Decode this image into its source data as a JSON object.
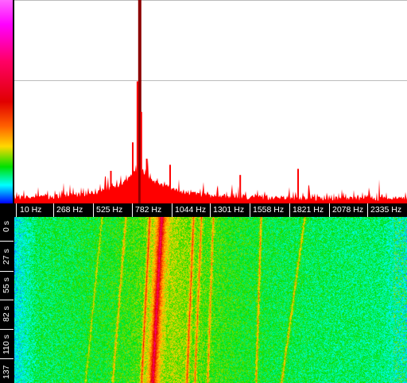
{
  "frequency_axis": {
    "labels": [
      "10 Hz",
      "268 Hz",
      "525 Hz",
      "782 Hz",
      "1044 Hz",
      "1301 Hz",
      "1558 Hz",
      "1821 Hz",
      "2078 Hz",
      "2335 Hz"
    ],
    "values": [
      10,
      268,
      525,
      782,
      1044,
      1301,
      1558,
      1821,
      2078,
      2335
    ],
    "range": [
      0,
      2520
    ]
  },
  "time_axis": {
    "labels": [
      "0 s",
      "27 s",
      "55 s",
      "82 s",
      "110 s",
      "137"
    ],
    "values": [
      0,
      27,
      55,
      82,
      110,
      137
    ]
  },
  "spectrum": {
    "peaks": [
      {
        "freq": 805,
        "level": 1.0
      },
      {
        "freq": 790,
        "level": 0.6
      },
      {
        "freq": 815,
        "level": 0.45
      },
      {
        "freq": 760,
        "level": 0.3
      },
      {
        "freq": 850,
        "level": 0.22
      },
      {
        "freq": 1000,
        "level": 0.19
      },
      {
        "freq": 620,
        "level": 0.16
      },
      {
        "freq": 1821,
        "level": 0.17
      },
      {
        "freq": 1450,
        "level": 0.14
      }
    ],
    "colors": {
      "trace": "#ff0000",
      "peak": "#8b0000",
      "background": "#ffffff",
      "gridline": "#bbbbbb"
    }
  },
  "colormap": [
    "#0000ff",
    "#00ffff",
    "#00e000",
    "#ffd800",
    "#ff6000",
    "#e00000",
    "#ff0066",
    "#ff00ff",
    "#ff66ff"
  ]
}
